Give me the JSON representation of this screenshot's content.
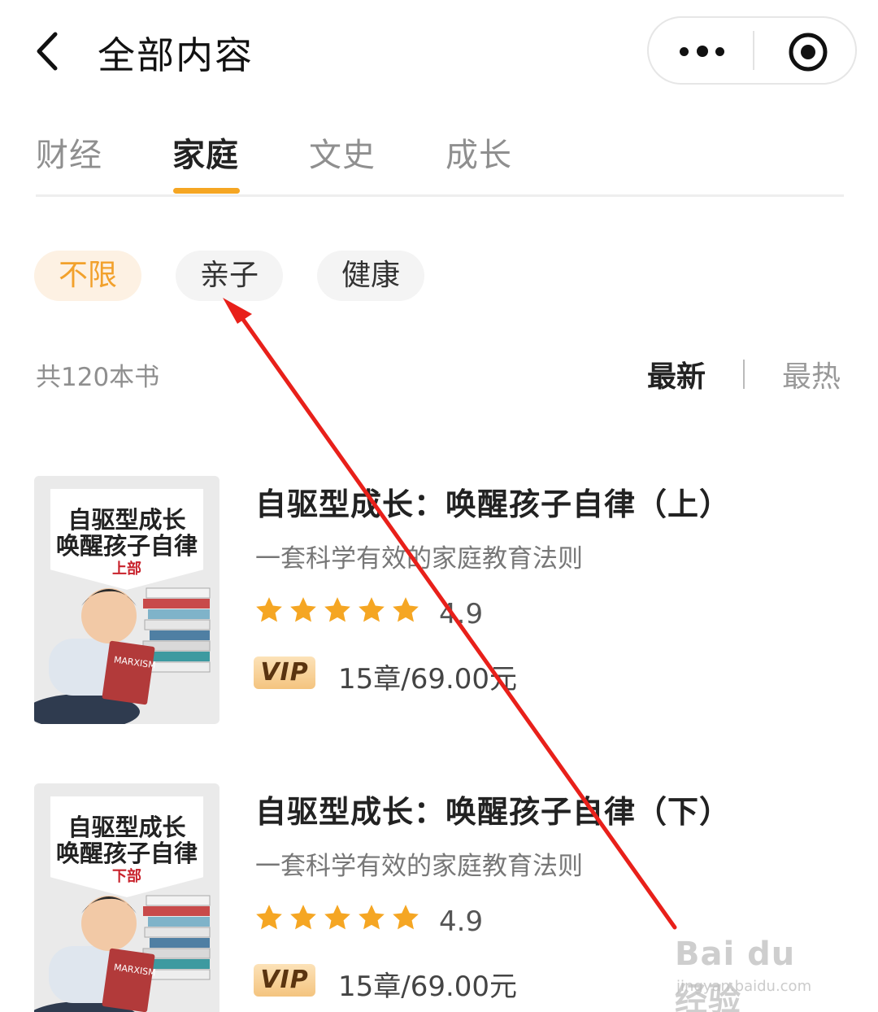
{
  "header": {
    "title": "全部内容",
    "back_icon": "chevron-left-icon",
    "more_icon": "more-dots-icon",
    "target_icon": "target-icon"
  },
  "tabs": [
    {
      "label": "财经",
      "active": false
    },
    {
      "label": "家庭",
      "active": true
    },
    {
      "label": "文史",
      "active": false
    },
    {
      "label": "成长",
      "active": false
    }
  ],
  "filters": [
    {
      "label": "不限",
      "active": true
    },
    {
      "label": "亲子",
      "active": false
    },
    {
      "label": "健康",
      "active": false
    }
  ],
  "list_header": {
    "count": "共120本书",
    "sort_newest": "最新",
    "sort_hottest": "最热"
  },
  "books": [
    {
      "title": "自驱型成长：唤醒孩子自律（上）",
      "subtitle": "一套科学有效的家庭教育法则",
      "rating": "4.9",
      "stars": 5,
      "vip": "VIP",
      "price": "15章/69.00元",
      "cover_line1": "自驱型成长",
      "cover_line2": "唤醒孩子自律",
      "cover_part": "上部"
    },
    {
      "title": "自驱型成长：唤醒孩子自律（下）",
      "subtitle": "一套科学有效的家庭教育法则",
      "rating": "4.9",
      "stars": 5,
      "vip": "VIP",
      "price": "15章/69.00元",
      "cover_line1": "自驱型成长",
      "cover_line2": "唤醒孩子自律",
      "cover_part": "下部"
    }
  ],
  "watermark": {
    "text": "Bai du 经验",
    "url": "jingyan.baidu.com"
  },
  "colors": {
    "accent": "#f5a623",
    "chip_active_bg": "#fdf1e3",
    "star": "#f5a623",
    "annotation_arrow": "#e8201a"
  }
}
